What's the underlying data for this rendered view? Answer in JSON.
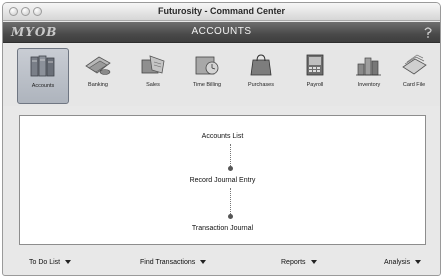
{
  "window": {
    "title": "Futurosity - Command Center"
  },
  "banner": {
    "logo": "MYOB",
    "section_title": "ACCOUNTS"
  },
  "command_centers": [
    {
      "label": "Accounts",
      "icon": "accounts-icon",
      "active": true
    },
    {
      "label": "Banking",
      "icon": "banking-icon",
      "active": false
    },
    {
      "label": "Sales",
      "icon": "sales-icon",
      "active": false
    },
    {
      "label": "Time Billing",
      "icon": "time-billing-icon",
      "active": false
    },
    {
      "label": "Purchases",
      "icon": "purchases-icon",
      "active": false
    },
    {
      "label": "Payroll",
      "icon": "payroll-icon",
      "active": false
    },
    {
      "label": "Inventory",
      "icon": "inventory-icon",
      "active": false
    },
    {
      "label": "Card File",
      "icon": "card-file-icon",
      "active": false
    }
  ],
  "flow": {
    "accounts_list": "Accounts List",
    "record_journal_entry": "Record Journal Entry",
    "transaction_journal": "Transaction Journal"
  },
  "bottom_menu": {
    "to_do_list": "To Do List",
    "find_transactions": "Find Transactions",
    "reports": "Reports",
    "analysis": "Analysis"
  }
}
